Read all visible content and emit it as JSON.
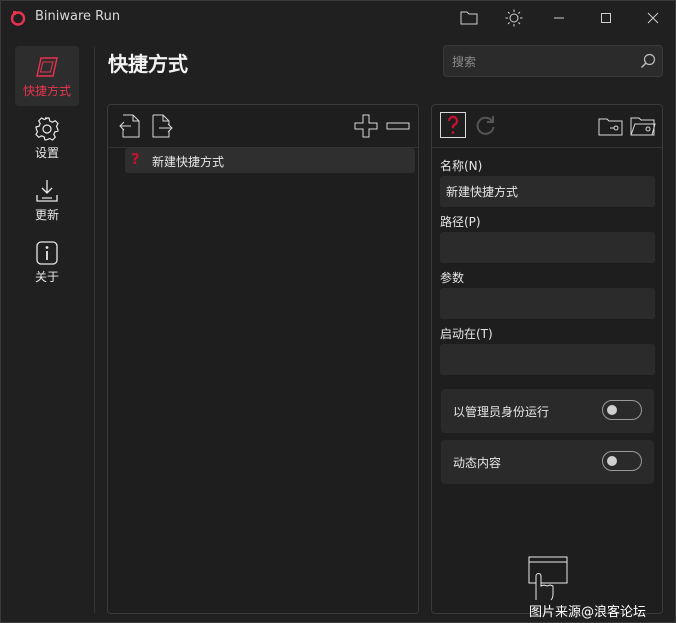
{
  "window": {
    "title": "Biniware Run"
  },
  "sidebar": {
    "items": [
      {
        "label": "快捷方式",
        "icon": "shortcut-icon",
        "active": true
      },
      {
        "label": "设置",
        "icon": "gear-icon"
      },
      {
        "label": "更新",
        "icon": "download-icon"
      },
      {
        "label": "关于",
        "icon": "info-icon"
      }
    ]
  },
  "header": {
    "title": "快捷方式"
  },
  "search": {
    "placeholder": "搜索"
  },
  "shortcut_list": {
    "items": [
      {
        "label": "新建快捷方式",
        "icon": "question-icon"
      }
    ]
  },
  "details": {
    "name_label": "名称(N)",
    "name_value": "新建快捷方式",
    "path_label": "路径(P)",
    "path_value": "",
    "args_label": "参数",
    "args_value": "",
    "startin_label": "启动在(T)",
    "startin_value": "",
    "run_as_admin_label": "以管理员身份运行",
    "run_as_admin_on": false,
    "dynamic_content_label": "动态内容",
    "dynamic_content_on": false
  },
  "watermark": {
    "text": "图片来源@浪客论坛"
  },
  "colors": {
    "accent": "#e8334f",
    "background": "#202020",
    "panel": "#2b2b2b"
  }
}
